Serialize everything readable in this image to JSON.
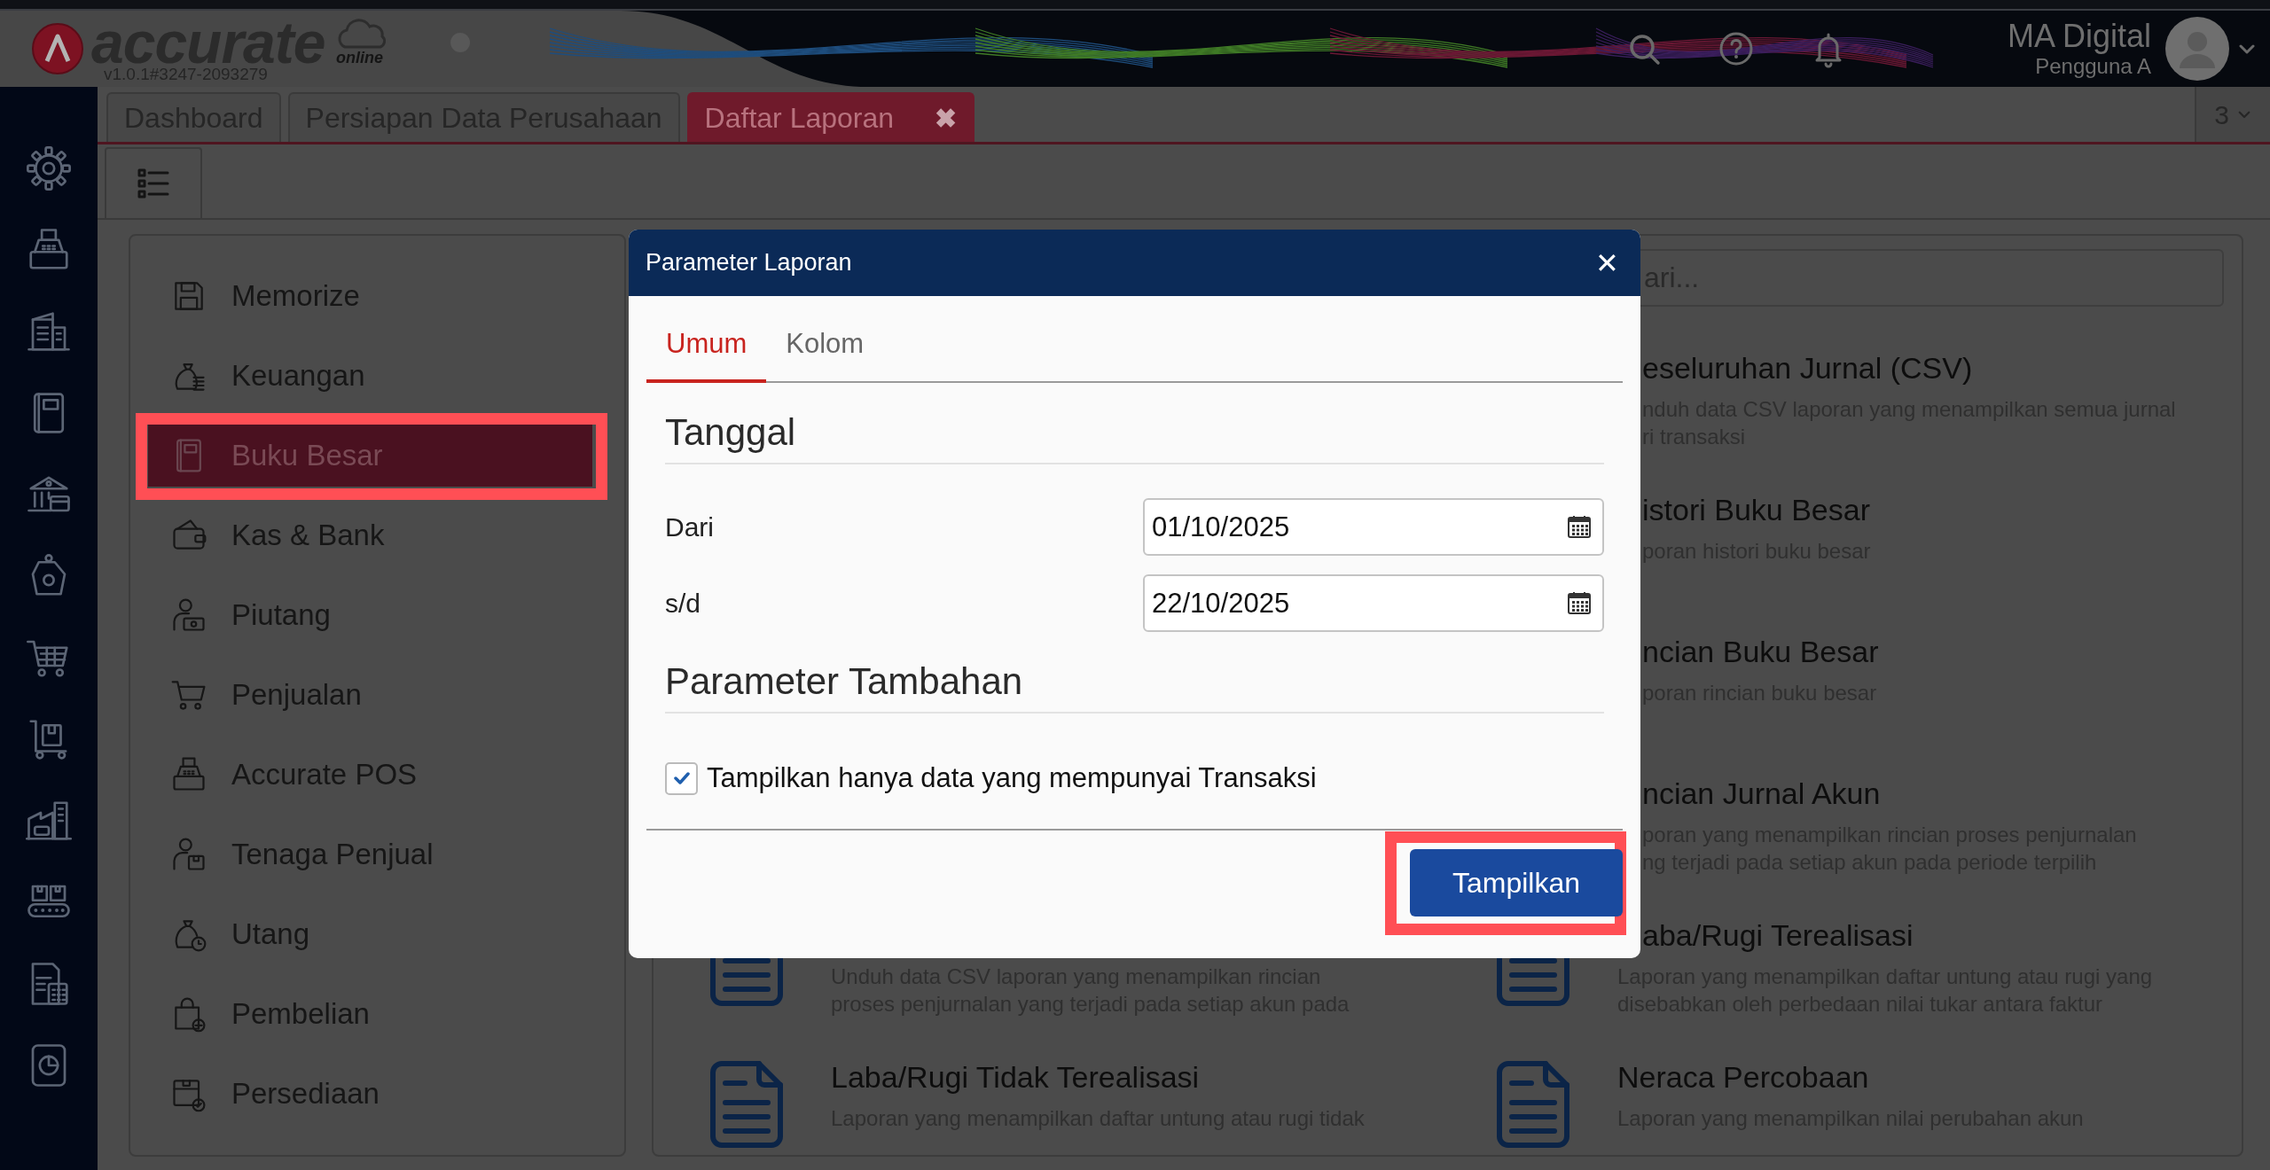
{
  "app": {
    "logo": "accurate",
    "logo_sub": "online",
    "version": "v1.0.1#3247-2093279"
  },
  "user": {
    "company": "MA Digital",
    "role": "Pengguna A"
  },
  "tabs": [
    {
      "label": "Dashboard",
      "selected": false
    },
    {
      "label": "Persiapan Data Perusahaan",
      "selected": false
    },
    {
      "label": "Daftar Laporan",
      "selected": true,
      "close": "✖"
    }
  ],
  "tab_count": "3",
  "categories": [
    {
      "label": "Memorize",
      "selected": false,
      "annotated": false
    },
    {
      "label": "Keuangan",
      "selected": false,
      "annotated": false
    },
    {
      "label": "Buku Besar",
      "selected": true,
      "annotated": true
    },
    {
      "label": "Kas & Bank",
      "selected": false,
      "annotated": false
    },
    {
      "label": "Piutang",
      "selected": false,
      "annotated": false
    },
    {
      "label": "Penjualan",
      "selected": false,
      "annotated": false
    },
    {
      "label": "Accurate POS",
      "selected": false,
      "annotated": false
    },
    {
      "label": "Tenaga Penjual",
      "selected": false,
      "annotated": false
    },
    {
      "label": "Utang",
      "selected": false,
      "annotated": false
    },
    {
      "label": "Pembelian",
      "selected": false,
      "annotated": false
    },
    {
      "label": "Persediaan",
      "selected": false,
      "annotated": false
    }
  ],
  "search": {
    "placeholder": "ari..."
  },
  "reports": [
    {
      "kind": "cut",
      "title": "eseluruhan Jurnal (CSV)",
      "lines": [
        "nduh data CSV laporan yang menampilkan semua jurnal",
        "ri transaksi"
      ]
    },
    {
      "kind": "cut",
      "title": "istori Buku Besar",
      "lines": [
        "poran histori buku besar"
      ]
    },
    {
      "kind": "cut",
      "title": "ncian Buku Besar",
      "lines": [
        "poran rincian buku besar"
      ]
    },
    {
      "kind": "cut",
      "title": "ncian Jurnal Akun",
      "lines": [
        "poran yang menampilkan rincian proses penjurnalan",
        "ng terjadi pada setiap akun pada periode terpilih"
      ]
    },
    {
      "kind": "untitled",
      "lines": [
        "Unduh data CSV laporan yang menampilkan rincian",
        "proses penjurnalan yang terjadi pada setiap akun pada"
      ]
    },
    {
      "kind": "cut-title",
      "title": "aba/Rugi Terealisasi",
      "lines": [
        "Laporan yang menampilkan daftar untung atau rugi yang",
        "disebabkan oleh perbedaan nilai tukar antara faktur"
      ]
    },
    {
      "kind": "report",
      "title": "Laba/Rugi Tidak Terealisasi",
      "lines": [
        "Laporan yang menampilkan daftar untung atau rugi tidak"
      ]
    },
    {
      "kind": "report",
      "title": "Neraca Percobaan",
      "lines": [
        "Laporan yang menampilkan nilai perubahan akun"
      ]
    }
  ],
  "dialog": {
    "title": "Parameter Laporan",
    "close": "✕",
    "tabs": [
      {
        "label": "Umum",
        "selected": true
      },
      {
        "label": "Kolom",
        "selected": false
      }
    ],
    "sections": [
      {
        "kind": "dates",
        "heading": "Tanggal",
        "fields": [
          {
            "label": "Dari",
            "value": "01/10/2025"
          },
          {
            "label": "s/d",
            "value": "22/10/2025"
          }
        ]
      },
      {
        "kind": "checks",
        "heading": "Parameter Tambahan",
        "checks": [
          {
            "label": "Tampilkan hanya data yang mempunyai Transaksi",
            "checked": true
          }
        ]
      }
    ],
    "button": {
      "label": "Tampilkan",
      "annotated": true
    }
  }
}
